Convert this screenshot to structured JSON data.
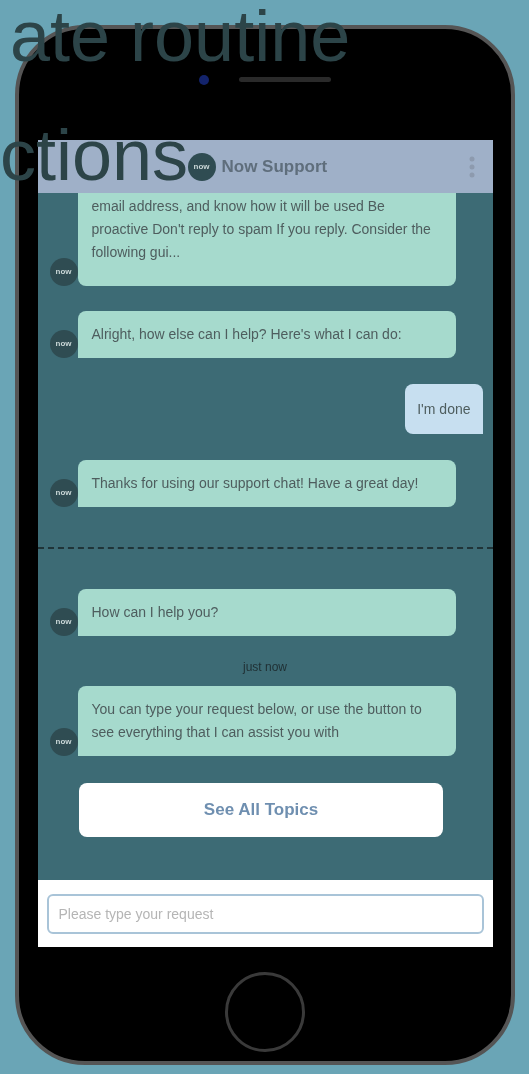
{
  "overlay_text": [
    "ate routine",
    "ctions"
  ],
  "header": {
    "avatar": "now",
    "title": "Now Support"
  },
  "messages": [
    {
      "kind": "bot",
      "avatar": "now",
      "text": "email address, and know how it will be used Be proactive   Don't reply to spam If you reply. Consider the following gui...",
      "cut": true
    },
    {
      "kind": "bot",
      "avatar": "now",
      "text": "Alright, how else can I help? Here's what I can do:",
      "cut": false
    },
    {
      "kind": "user",
      "text": "I'm done"
    },
    {
      "kind": "bot",
      "avatar": "now",
      "text": "Thanks for using our support chat! Have a great day!",
      "cut": false
    },
    {
      "kind": "divider"
    },
    {
      "kind": "bot",
      "avatar": "now",
      "text": "How can I help you?",
      "cut": false
    },
    {
      "kind": "time",
      "text": "just now"
    },
    {
      "kind": "bot",
      "avatar": "now",
      "text": "You can type your request below, or use the button to see everything that I can assist you with",
      "cut": false
    },
    {
      "kind": "button",
      "text": "See All Topics"
    }
  ],
  "input": {
    "placeholder": "Please type your request"
  }
}
